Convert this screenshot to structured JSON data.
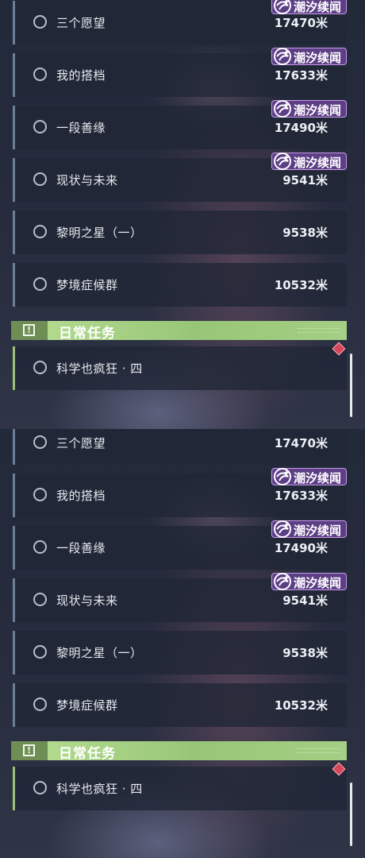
{
  "screens": [
    {
      "quests": [
        {
          "name": "三个愿望",
          "distance": "17470米",
          "tag": "潮汐续闻"
        },
        {
          "name": "我的搭档",
          "distance": "17633米",
          "tag": "潮汐续闻"
        },
        {
          "name": "一段善缘",
          "distance": "17490米",
          "tag": "潮汐续闻"
        },
        {
          "name": "现状与未来",
          "distance": "9541米",
          "tag": "潮汐续闻"
        },
        {
          "name": "黎明之星（一）",
          "distance": "9538米"
        },
        {
          "name": "梦境症候群",
          "distance": "10532米"
        }
      ],
      "daily_section": {
        "title": "日常任务",
        "icon": "exclamation-icon"
      },
      "daily_quests": [
        {
          "name": "科学也疯狂 · 四"
        }
      ]
    },
    {
      "quests": [
        {
          "name": "三个愿望",
          "distance": "17470米",
          "tag": "潮汐续闻"
        },
        {
          "name": "我的搭档",
          "distance": "17633米",
          "tag": "潮汐续闻"
        },
        {
          "name": "一段善缘",
          "distance": "17490米",
          "tag": "潮汐续闻"
        },
        {
          "name": "现状与未来",
          "distance": "9541米",
          "tag": "潮汐续闻"
        },
        {
          "name": "黎明之星（一）",
          "distance": "9538米"
        },
        {
          "name": "梦境症候群",
          "distance": "10532米"
        }
      ],
      "daily_section": {
        "title": "日常任务",
        "icon": "exclamation-icon"
      },
      "daily_quests": [
        {
          "name": "科学也疯狂 · 四"
        }
      ]
    }
  ],
  "colors": {
    "tag_bg": "#5d3f86",
    "tag_border": "#c59be8",
    "daily_bar": "#a4cf84",
    "track_marker": "#d6465a"
  }
}
